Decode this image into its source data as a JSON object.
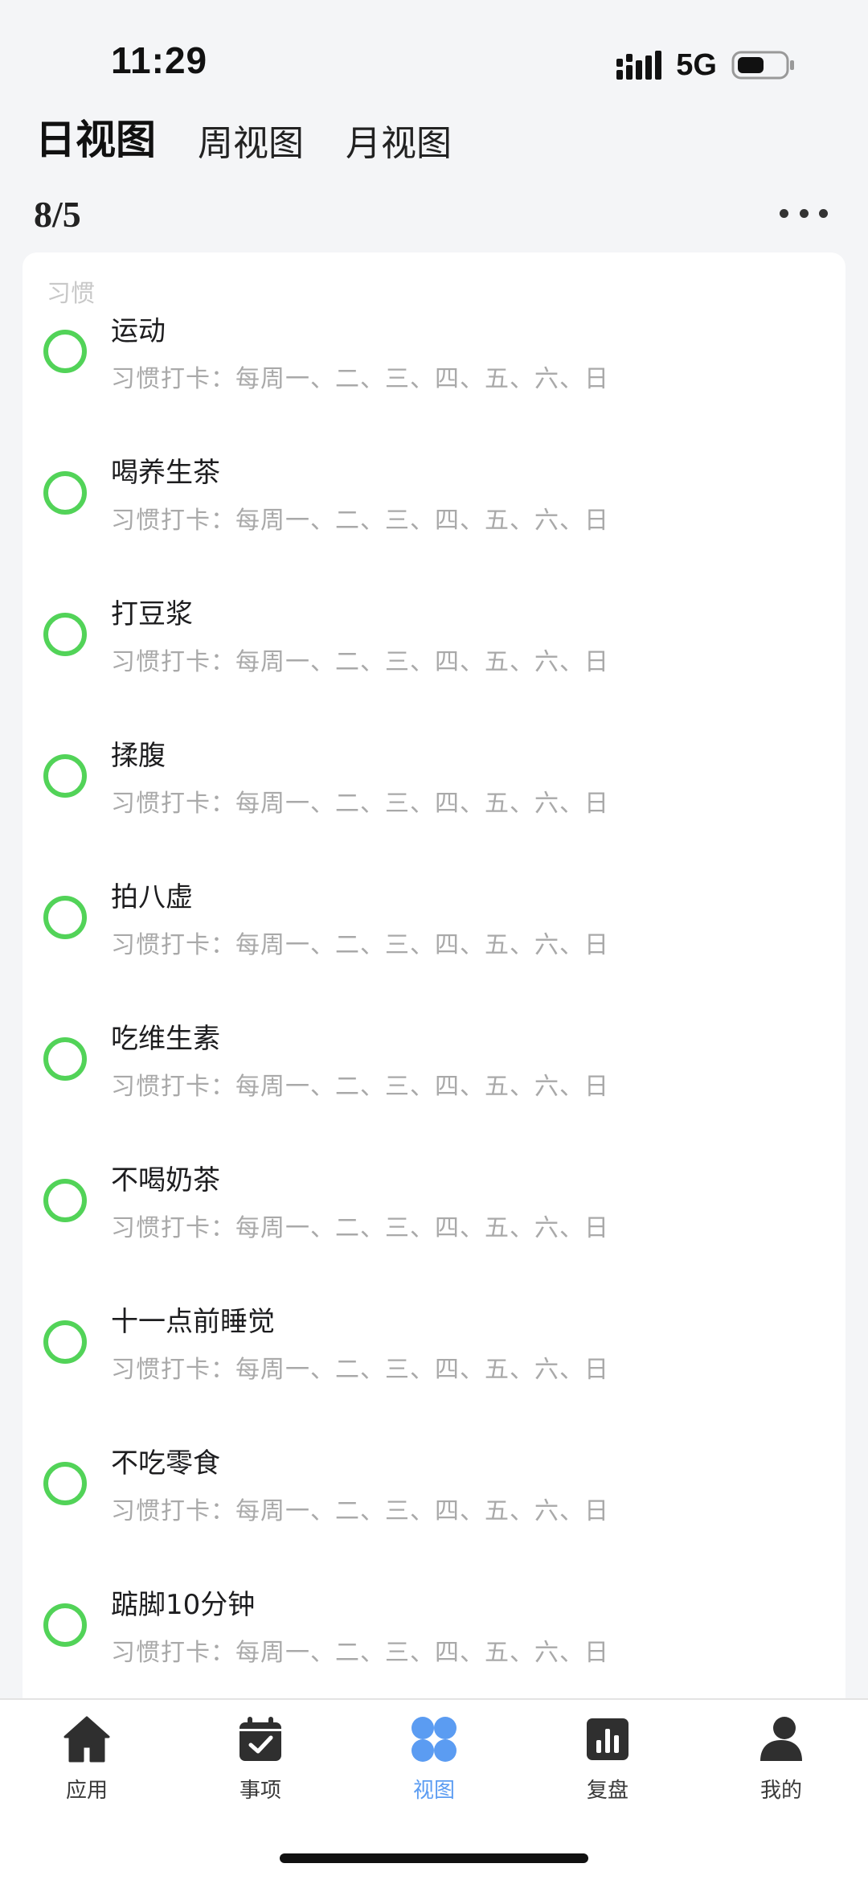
{
  "status_bar": {
    "time": "11:29",
    "network": "5G",
    "icons": [
      "signal-icon",
      "battery-icon"
    ]
  },
  "view_tabs": [
    {
      "label": "日视图",
      "active": true
    },
    {
      "label": "周视图",
      "active": false
    },
    {
      "label": "月视图",
      "active": false
    }
  ],
  "date": "8/5",
  "more_icon": "more-horizontal-icon",
  "section_label": "习惯",
  "habits": [
    {
      "title": "运动",
      "schedule": "习惯打卡：每周一、二、三、四、五、六、日"
    },
    {
      "title": "喝养生茶",
      "schedule": "习惯打卡：每周一、二、三、四、五、六、日"
    },
    {
      "title": "打豆浆",
      "schedule": "习惯打卡：每周一、二、三、四、五、六、日"
    },
    {
      "title": "揉腹",
      "schedule": "习惯打卡：每周一、二、三、四、五、六、日"
    },
    {
      "title": "拍八虚",
      "schedule": "习惯打卡：每周一、二、三、四、五、六、日"
    },
    {
      "title": "吃维生素",
      "schedule": "习惯打卡：每周一、二、三、四、五、六、日"
    },
    {
      "title": "不喝奶茶",
      "schedule": "习惯打卡：每周一、二、三、四、五、六、日"
    },
    {
      "title": "十一点前睡觉",
      "schedule": "习惯打卡：每周一、二、三、四、五、六、日"
    },
    {
      "title": "不吃零食",
      "schedule": "习惯打卡：每周一、二、三、四、五、六、日"
    },
    {
      "title": "踮脚10分钟",
      "schedule": "习惯打卡：每周一、二、三、四、五、六、日"
    }
  ],
  "colors": {
    "check_ring": "#52d358",
    "active_tab": "#5b9cf2",
    "icon_dark": "#2f2f2f",
    "background": "#f4f5f7"
  },
  "tab_bar": [
    {
      "label": "应用",
      "icon": "home-icon",
      "active": false
    },
    {
      "label": "事项",
      "icon": "calendar-check-icon",
      "active": false
    },
    {
      "label": "视图",
      "icon": "four-petal-grid-icon",
      "active": true
    },
    {
      "label": "复盘",
      "icon": "bar-chart-icon",
      "active": false
    },
    {
      "label": "我的",
      "icon": "user-icon",
      "active": false
    }
  ]
}
